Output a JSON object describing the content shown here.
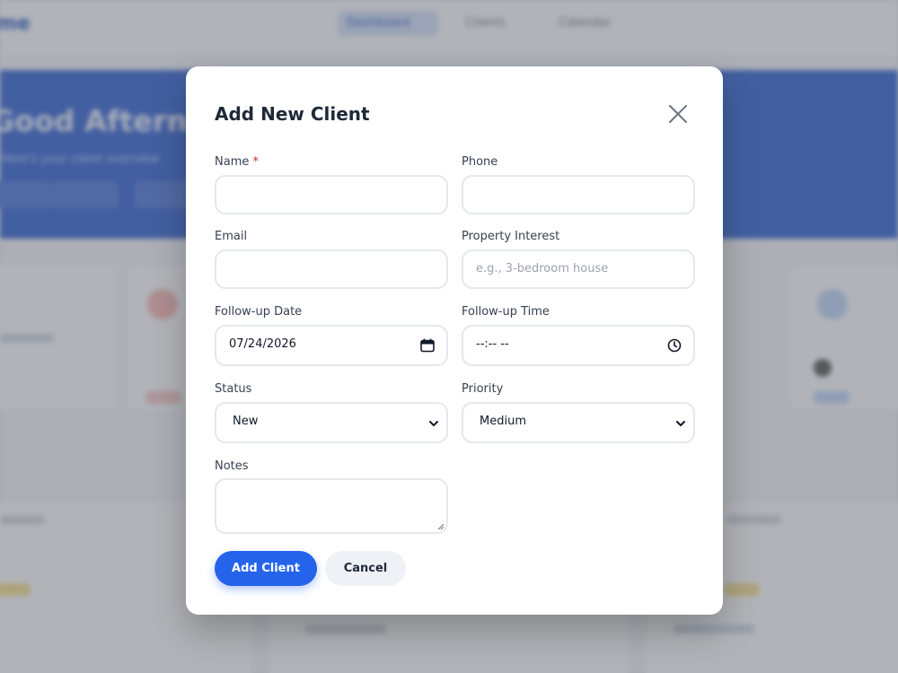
{
  "background": {
    "brand": "me",
    "nav": [
      "Dashboard",
      "Clients",
      "Calendar"
    ],
    "hero_title": "Good Afternoon, Nyx",
    "hero_subtitle": "Here's your client overview"
  },
  "modal": {
    "title": "Add New Client",
    "close_icon": "close-icon",
    "fields": {
      "name": {
        "label": "Name",
        "required_mark": "*",
        "value": "",
        "placeholder": ""
      },
      "phone": {
        "label": "Phone",
        "value": "",
        "placeholder": ""
      },
      "email": {
        "label": "Email",
        "value": "",
        "placeholder": ""
      },
      "property_interest": {
        "label": "Property Interest",
        "value": "",
        "placeholder": "e.g., 3-bedroom house"
      },
      "followup_date": {
        "label": "Follow-up Date",
        "value": "07/24/2026",
        "icon": "calendar-icon"
      },
      "followup_time": {
        "label": "Follow-up Time",
        "value": "--:-- --",
        "icon": "clock-icon"
      },
      "status": {
        "label": "Status",
        "value": "New"
      },
      "priority": {
        "label": "Priority",
        "value": "Medium"
      },
      "notes": {
        "label": "Notes",
        "value": ""
      }
    },
    "buttons": {
      "submit": "Add Client",
      "cancel": "Cancel"
    }
  },
  "colors": {
    "primary": "#2563eb",
    "required": "#dc2626",
    "overlay": "rgba(90,95,105,0.45)"
  }
}
